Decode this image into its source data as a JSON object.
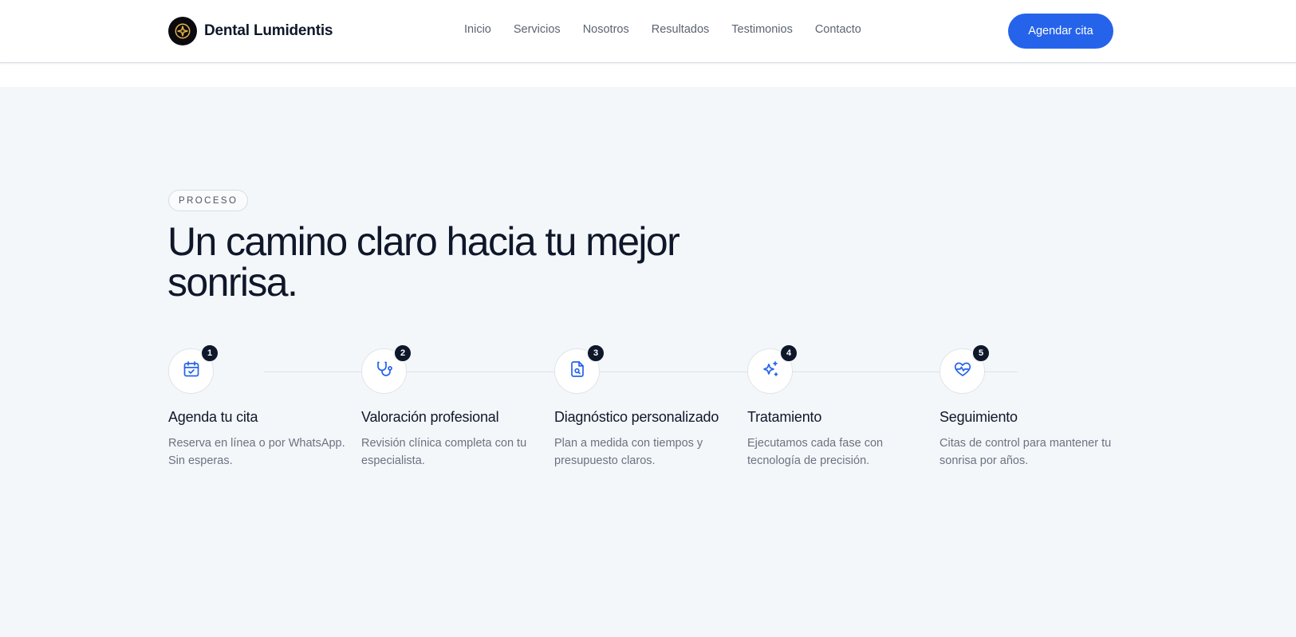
{
  "header": {
    "brand_name": "Dental Lumidentis",
    "logo_icon": "sparkle-icon",
    "nav": [
      {
        "label": "Inicio"
      },
      {
        "label": "Servicios"
      },
      {
        "label": "Nosotros"
      },
      {
        "label": "Resultados"
      },
      {
        "label": "Testimonios"
      },
      {
        "label": "Contacto"
      }
    ],
    "cta_label": "Agendar cita"
  },
  "process": {
    "eyebrow": "PROCESO",
    "heading": "Un camino claro hacia tu mejor sonrisa.",
    "steps": [
      {
        "number": "1",
        "icon": "calendar-check-icon",
        "title": "Agenda tu cita",
        "description": "Reserva en línea o por WhatsApp. Sin esperas."
      },
      {
        "number": "2",
        "icon": "stethoscope-icon",
        "title": "Valoración profesional",
        "description": "Revisión clínica completa con tu especialista."
      },
      {
        "number": "3",
        "icon": "file-search-icon",
        "title": "Diagnóstico personalizado",
        "description": "Plan a medida con tiempos y presupuesto claros."
      },
      {
        "number": "4",
        "icon": "sparkles-icon",
        "title": "Tratamiento",
        "description": "Ejecutamos cada fase con tecnología de precisión."
      },
      {
        "number": "5",
        "icon": "heart-pulse-icon",
        "title": "Seguimiento",
        "description": "Citas de control para mantener tu sonrisa por años."
      }
    ]
  },
  "colors": {
    "accent": "#2563eb",
    "dark": "#0f172a",
    "logo_gold": "#e6b34a",
    "section_bg": "#f4f7fa"
  }
}
